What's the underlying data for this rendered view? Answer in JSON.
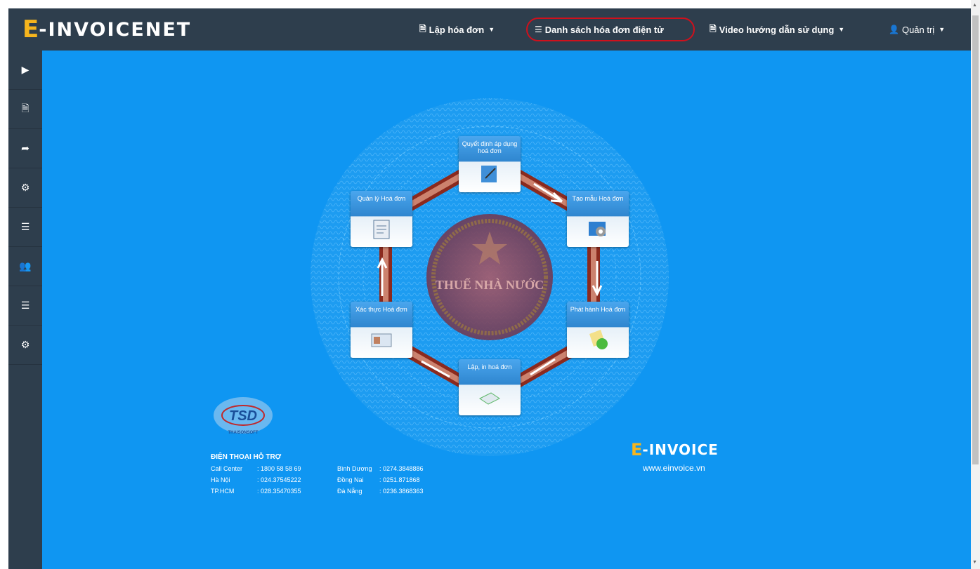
{
  "brand": {
    "logo_e": "E",
    "logo_rest": "-INVOICENET"
  },
  "nav": {
    "create_invoice": "Lập hóa đơn",
    "invoice_list": "Danh sách hóa đơn điện tử",
    "video_guide": "Video hướng dẫn sử dụng",
    "admin": "Quản trị"
  },
  "sidebar": {
    "items": [
      "play-icon",
      "file-icon",
      "share-icon",
      "cogs-icon",
      "list-icon",
      "users-icon",
      "list-icon",
      "cogs-icon"
    ]
  },
  "diagram": {
    "center_text": "THUẾ NHÀ NƯỚC",
    "steps": {
      "quyet_dinh": "Quyết định áp dụng hoá đơn",
      "tao_mau": "Tạo mẫu Hoá đơn",
      "phat_hanh": "Phát hành Hoá đơn",
      "lap_in": "Lập, in hoá đơn",
      "xac_thuc": "Xác thực Hoá đơn",
      "quan_ly": "Quản lý Hoá đơn"
    }
  },
  "support": {
    "logo_text": "TSD",
    "logo_sub": "THAISONSOFT",
    "heading": "ĐIỆN THOẠI HỖ TRỢ",
    "left": [
      {
        "label": "Call Center",
        "value": ": 1800 58 58 69"
      },
      {
        "label": "Hà Nội",
        "value": ": 024.37545222"
      },
      {
        "label": "TP.HCM",
        "value": ": 028.35470355"
      }
    ],
    "right": [
      {
        "label": "Bình Dương",
        "value": ": 0274.3848886"
      },
      {
        "label": "Đồng Nai",
        "value": ": 0251.871868"
      },
      {
        "label": "Đà Nẵng",
        "value": ": 0236.3868363"
      }
    ]
  },
  "einvoice": {
    "logo_e": "E",
    "logo_rest": "-INVOICE",
    "url": "www.einvoice.vn"
  },
  "colors": {
    "navbar": "#2e3e4d",
    "main_bg": "#0f96f2",
    "logo_accent": "#f6b51d",
    "highlight": "#d0101c"
  }
}
